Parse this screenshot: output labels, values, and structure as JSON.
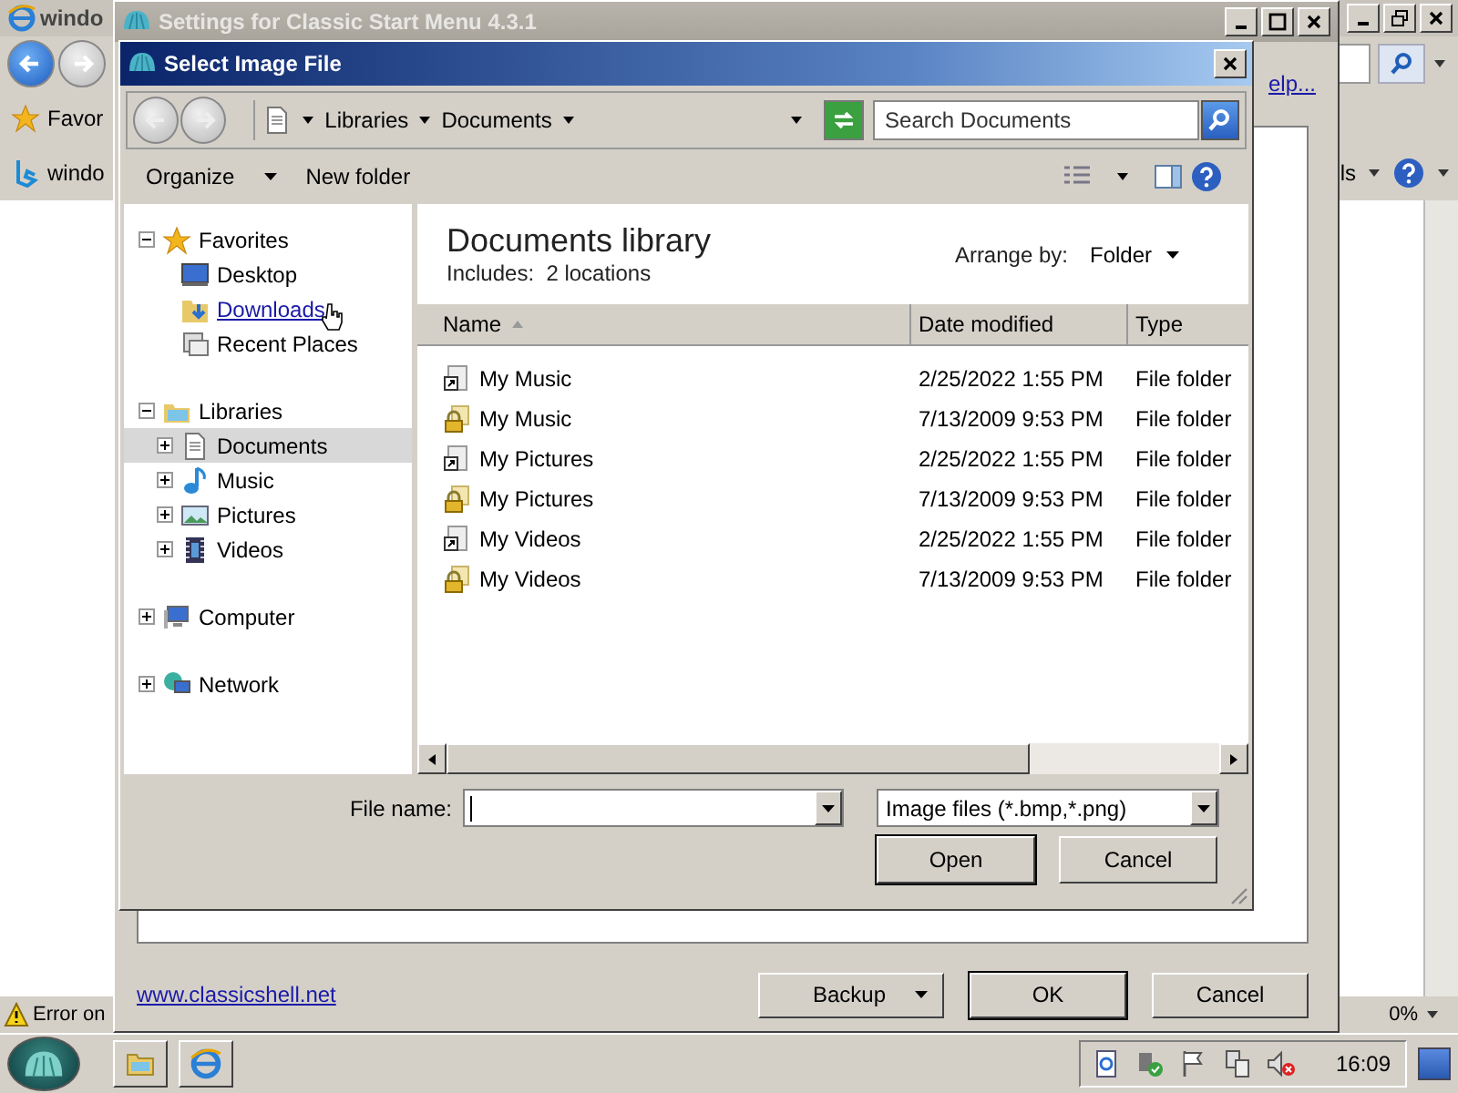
{
  "browser": {
    "title": "windo",
    "favorites": "Favor",
    "tab": "windo",
    "tools": "ls",
    "status": "Error on",
    "zoom": "0%"
  },
  "settings": {
    "title": "Settings for Classic Start Menu 4.3.1",
    "help_link": "elp...",
    "website": "www.classicshell.net",
    "buttons": [
      {
        "label": "Backup",
        "kind": "split"
      },
      {
        "label": "OK",
        "kind": "default"
      },
      {
        "label": "Cancel",
        "kind": "plain"
      }
    ]
  },
  "dialog": {
    "title": "Select Image File",
    "breadcrumb": [
      "Libraries",
      "Documents"
    ],
    "search": {
      "placeholder": "Search Documents"
    },
    "toolbar": [
      "Organize",
      "New folder"
    ],
    "nav": [
      {
        "label": "Favorites",
        "kind": "star",
        "expanded": true,
        "selected": false,
        "hovered": false,
        "children": [
          {
            "label": "Desktop",
            "kind": "desktop",
            "selected": false,
            "hovered": false
          },
          {
            "label": "Downloads",
            "kind": "downloads",
            "selected": false,
            "hovered": true
          },
          {
            "label": "Recent Places",
            "kind": "recent",
            "selected": false,
            "hovered": false
          }
        ]
      },
      {
        "label": "Libraries",
        "kind": "libraries",
        "expanded": true,
        "selected": false,
        "hovered": false,
        "children": [
          {
            "label": "Documents",
            "kind": "documents",
            "expanded": false,
            "selected": true,
            "hovered": false
          },
          {
            "label": "Music",
            "kind": "music",
            "expanded": false,
            "selected": false,
            "hovered": false
          },
          {
            "label": "Pictures",
            "kind": "pictures",
            "expanded": false,
            "selected": false,
            "hovered": false
          },
          {
            "label": "Videos",
            "kind": "videos",
            "expanded": false,
            "selected": false,
            "hovered": false
          }
        ]
      },
      {
        "label": "Computer",
        "kind": "computer",
        "expanded": false,
        "selected": false,
        "hovered": false
      },
      {
        "label": "Network",
        "kind": "network",
        "expanded": false,
        "selected": false,
        "hovered": false
      }
    ],
    "library": {
      "title": "Documents library",
      "includes": "Includes:  2 locations",
      "arrange_label": "Arrange by:",
      "arrange_value": "Folder"
    },
    "columns": [
      "Name",
      "Date modified",
      "Type"
    ],
    "rows": [
      {
        "name": "My Music",
        "kind": "shortcut",
        "date": "2/25/2022 1:55 PM",
        "type": "File folder"
      },
      {
        "name": "My Music",
        "kind": "locked",
        "date": "7/13/2009 9:53 PM",
        "type": "File folder"
      },
      {
        "name": "My Pictures",
        "kind": "shortcut",
        "date": "2/25/2022 1:55 PM",
        "type": "File folder"
      },
      {
        "name": "My Pictures",
        "kind": "locked",
        "date": "7/13/2009 9:53 PM",
        "type": "File folder"
      },
      {
        "name": "My Videos",
        "kind": "shortcut",
        "date": "2/25/2022 1:55 PM",
        "type": "File folder"
      },
      {
        "name": "My Videos",
        "kind": "locked",
        "date": "7/13/2009 9:53 PM",
        "type": "File folder"
      }
    ],
    "file_name": {
      "label": "File name:"
    },
    "file_type": "Image files (*.bmp,*.png)",
    "buttons": [
      {
        "label": "Open",
        "kind": "default"
      },
      {
        "label": "Cancel",
        "kind": "plain"
      }
    ]
  },
  "taskbar": {
    "clock": "16:09"
  }
}
